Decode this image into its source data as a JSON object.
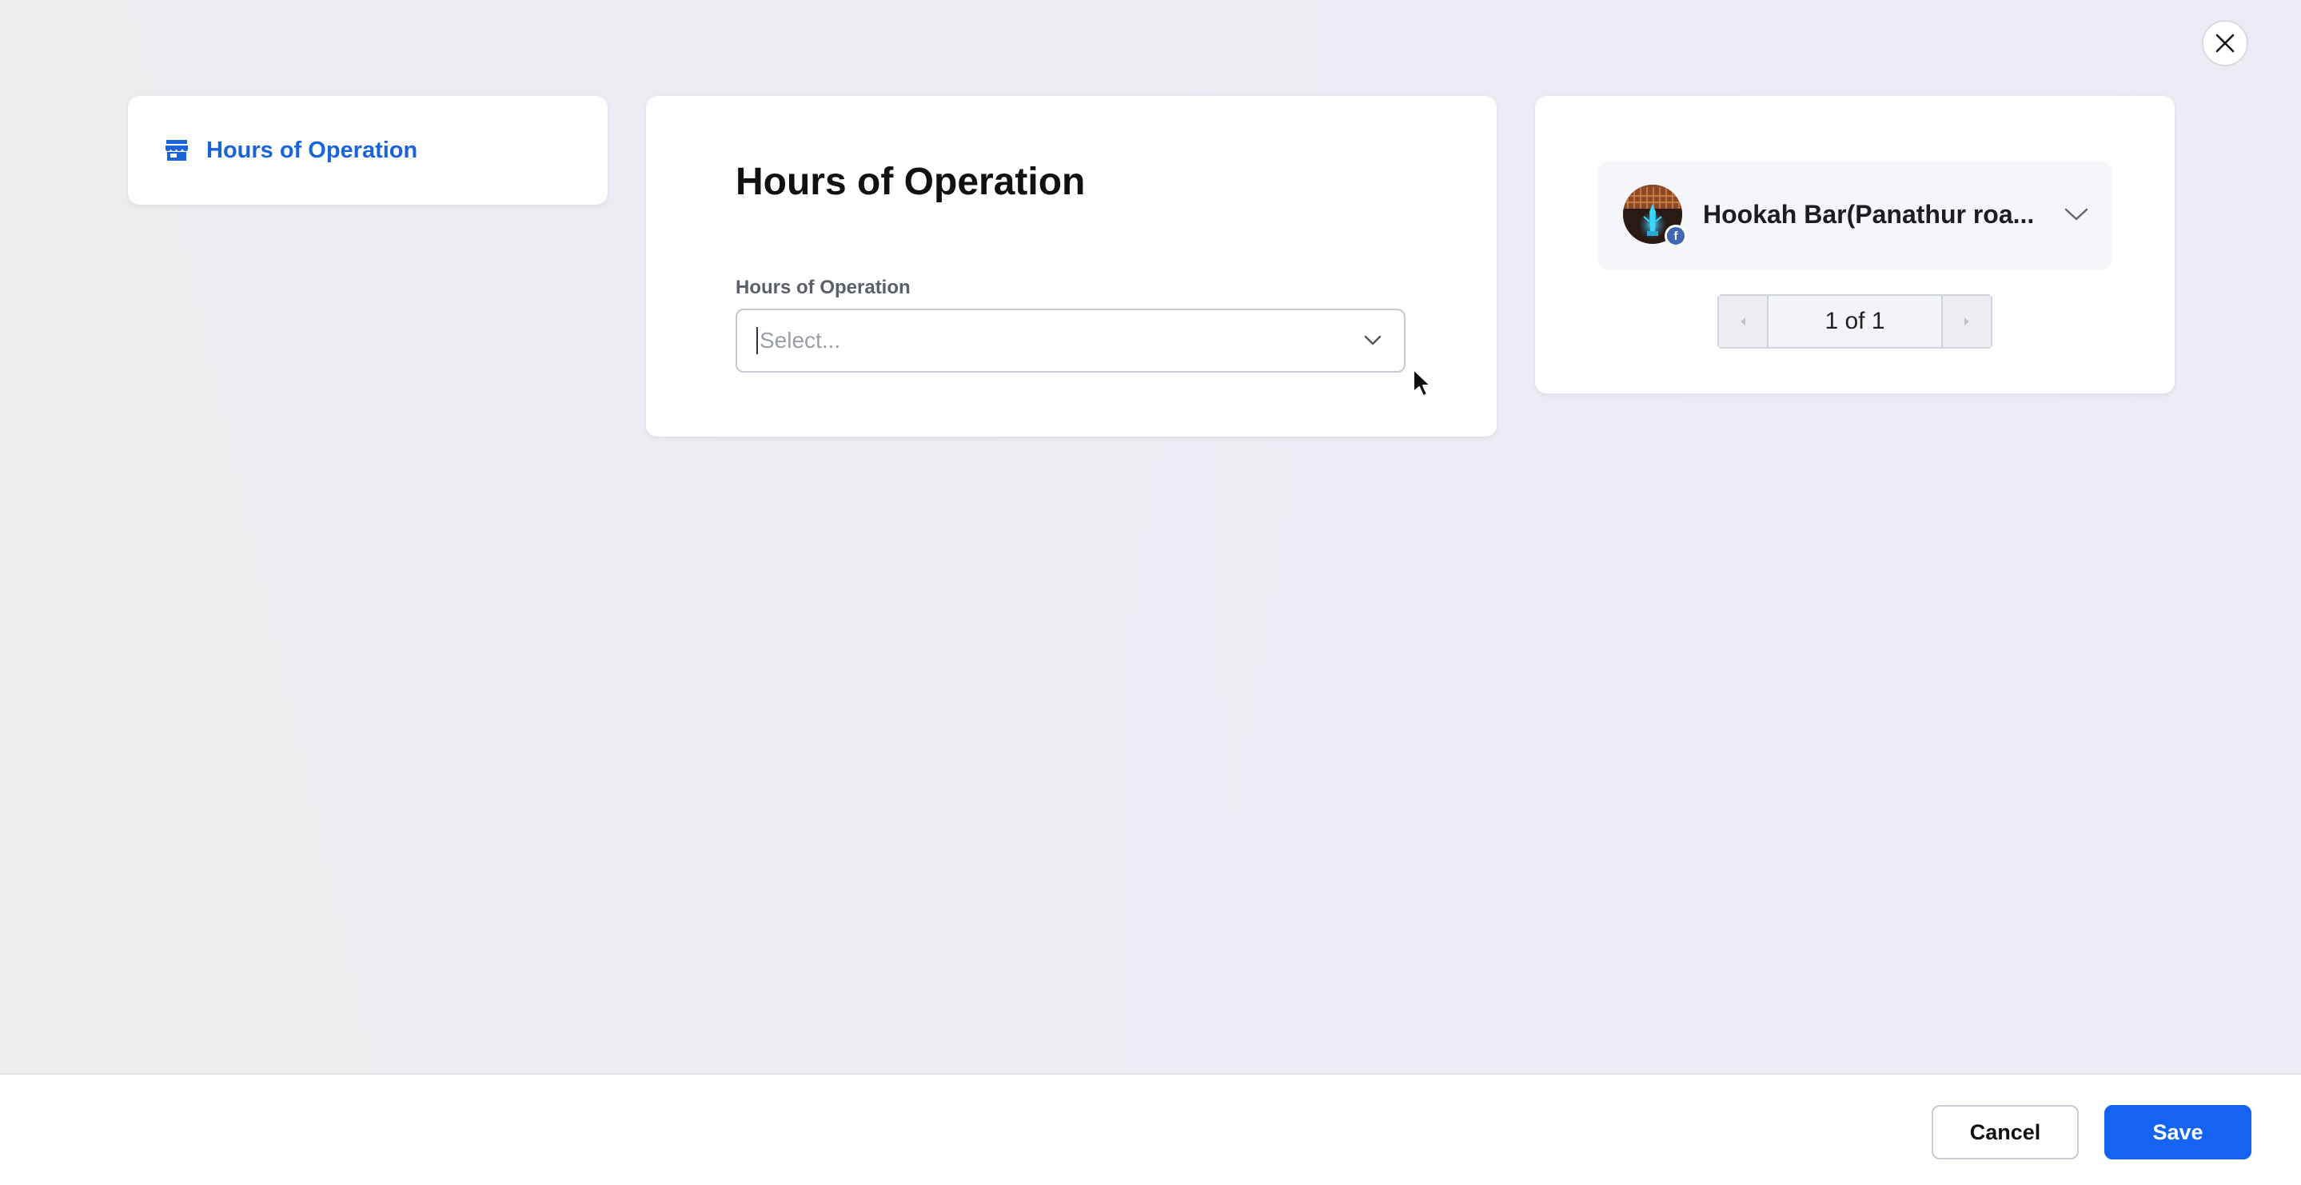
{
  "sidebar": {
    "items": [
      {
        "label": "Hours of Operation",
        "icon": "storefront-icon",
        "active": true
      }
    ]
  },
  "form": {
    "title": "Hours of Operation",
    "field_label": "Hours of Operation",
    "select_placeholder": "Select..."
  },
  "preview": {
    "account_name": "Hookah Bar(Panathur roa...",
    "network": "facebook",
    "network_badge": "f",
    "pager_text": "1 of 1"
  },
  "footer": {
    "cancel_label": "Cancel",
    "save_label": "Save"
  },
  "colors": {
    "accent": "#1463f3",
    "link": "#1b63d8",
    "facebook": "#4267b2"
  }
}
